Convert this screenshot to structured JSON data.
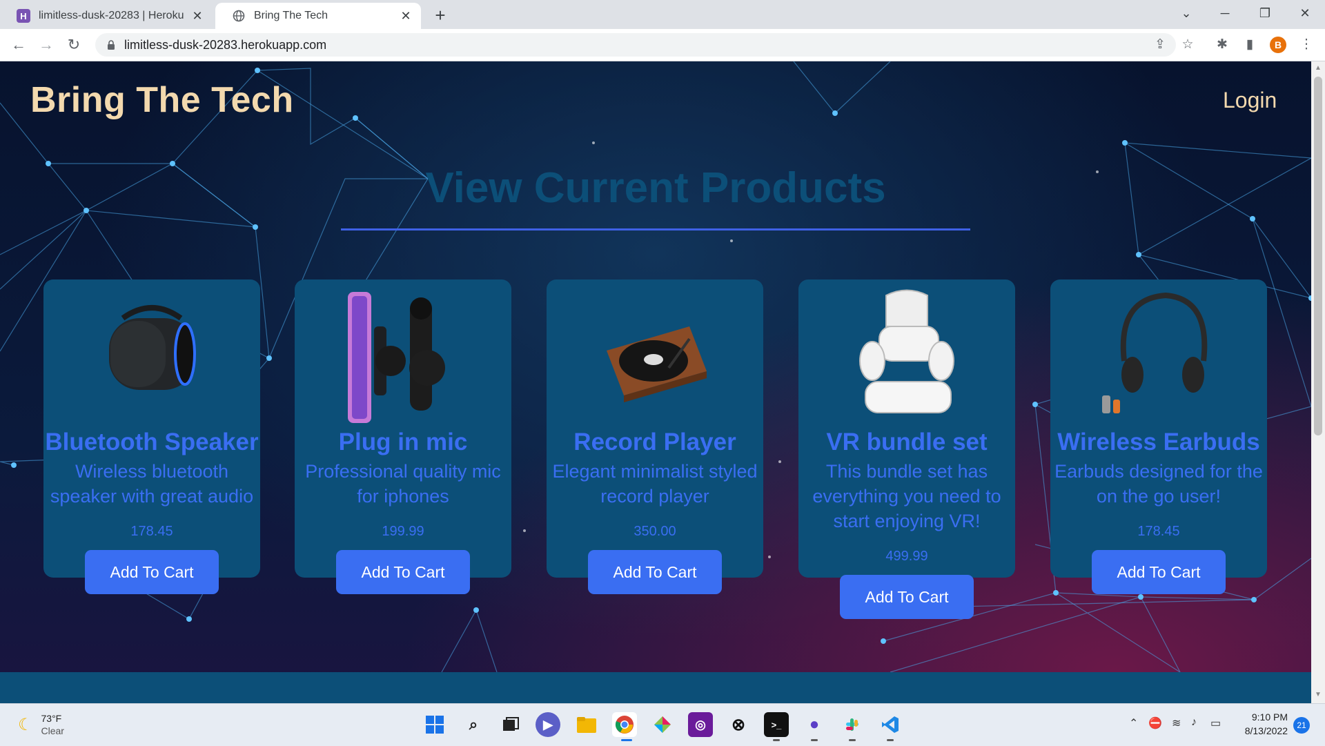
{
  "browser": {
    "tabs": [
      {
        "title": "limitless-dusk-20283 | Heroku",
        "favicon": "heroku-icon",
        "active": false
      },
      {
        "title": "Bring The Tech",
        "favicon": "globe-icon",
        "active": true
      }
    ],
    "url": "limitless-dusk-20283.herokuapp.com",
    "profile_initial": "B"
  },
  "site": {
    "brand": "Bring The Tech",
    "login_label": "Login",
    "heading": "View Current Products",
    "accent_color": "#3a6ef2",
    "card_color": "#0c4f78",
    "brand_color": "#f3d9ae"
  },
  "products": [
    {
      "name": "Bluetooth Speaker",
      "description": "Wireless bluetooth speaker with great audio",
      "price": "178.45",
      "button": "Add To Cart",
      "image": "bluetooth-speaker-image"
    },
    {
      "name": "Plug in mic",
      "description": "Professional quality mic for iphones",
      "price": "199.99",
      "button": "Add To Cart",
      "image": "plug-in-mic-image"
    },
    {
      "name": "Record Player",
      "description": "Elegant minimalist styled record player",
      "price": "350.00",
      "button": "Add To Cart",
      "image": "record-player-image"
    },
    {
      "name": "VR bundle set",
      "description": "This bundle set has everything you need to start enjoying VR!",
      "price": "499.99",
      "button": "Add To Cart",
      "image": "vr-bundle-image"
    },
    {
      "name": "Wireless Earbuds",
      "description": "Earbuds designed for the on the go user!",
      "price": "178.45",
      "button": "Add To Cart",
      "image": "wireless-earbuds-image"
    }
  ],
  "taskbar": {
    "weather_temp": "73°F",
    "weather_desc": "Clear",
    "time": "9:10 PM",
    "date": "8/13/2022",
    "notifications": "21"
  }
}
